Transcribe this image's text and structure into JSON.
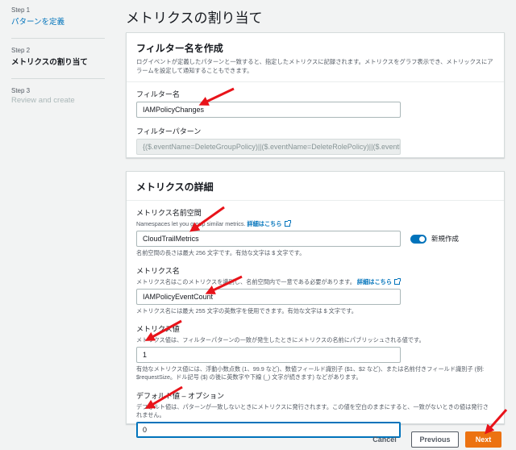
{
  "steps": [
    {
      "number": "Step 1",
      "label": "パターンを定義"
    },
    {
      "number": "Step 2",
      "label": "メトリクスの割り当て"
    },
    {
      "number": "Step 3",
      "label": "Review and create"
    }
  ],
  "page_title": "メトリクスの割り当て",
  "filter_panel": {
    "title": "フィルター名を作成",
    "description": "ログイベントが定義したパターンと一致すると、指定したメトリクスに記録されます。メトリクスをグラフ表示でき、メトリックスにアラームを設定して通知することもできます。",
    "filter_name_label": "フィルター名",
    "filter_name_value": "IAMPolicyChanges",
    "filter_pattern_label": "フィルターパターン",
    "filter_pattern_value": "{($.eventName=DeleteGroupPolicy)||($.eventName=DeleteRolePolicy)||($.eventNa"
  },
  "metric_panel": {
    "title": "メトリクスの詳細",
    "namespace_label": "メトリクス名前空間",
    "namespace_desc": "Namespaces let you group similar metrics.",
    "learn_more": "詳細はこちら",
    "namespace_value": "CloudTrailMetrics",
    "toggle_label": "新規作成",
    "namespace_hint": "名前空間の長さは最大 256 文字です。有効な文字は $ 文字です。",
    "metric_name_label": "メトリクス名",
    "metric_name_desc": "メトリクス名はこのメトリクスを識別し、名前空間内で一意である必要があります。",
    "metric_name_value": "IAMPolicyEventCount",
    "metric_name_hint": "メトリクス名には最大 255 文字の英数字を使用できます。有効な文字は $ 文字です。",
    "metric_value_label": "メトリクス値",
    "metric_value_desc": "メトリクス値は、フィルターパターンの一致が発生したときにメトリクスの名前にパブリッシュされる値です。",
    "metric_value_value": "1",
    "metric_value_hint": "有効なメトリクス値には、浮動小数点数 (1、99.9 など)、数値フィールド識別子 ($1、$2 など)、または名前付きフィールド識別子 (例: $requestSize。ドル記号 ($) の後に英数字や下線 (_) 文字が続きます) などがあります。",
    "default_value_label": "デフォルト値 – オプション",
    "default_value_desc": "デフォルト値は、パターンが一致しないときにメトリクスに発行されます。この値を空白のままにすると、一致がないときの値は発行されません。",
    "default_value_value": "0"
  },
  "footer": {
    "cancel_label": "Cancel",
    "previous_label": "Previous",
    "next_label": "Next"
  },
  "colors": {
    "link": "#0073bb",
    "primary_button": "#ec7211",
    "annotation": "#e8131a"
  }
}
